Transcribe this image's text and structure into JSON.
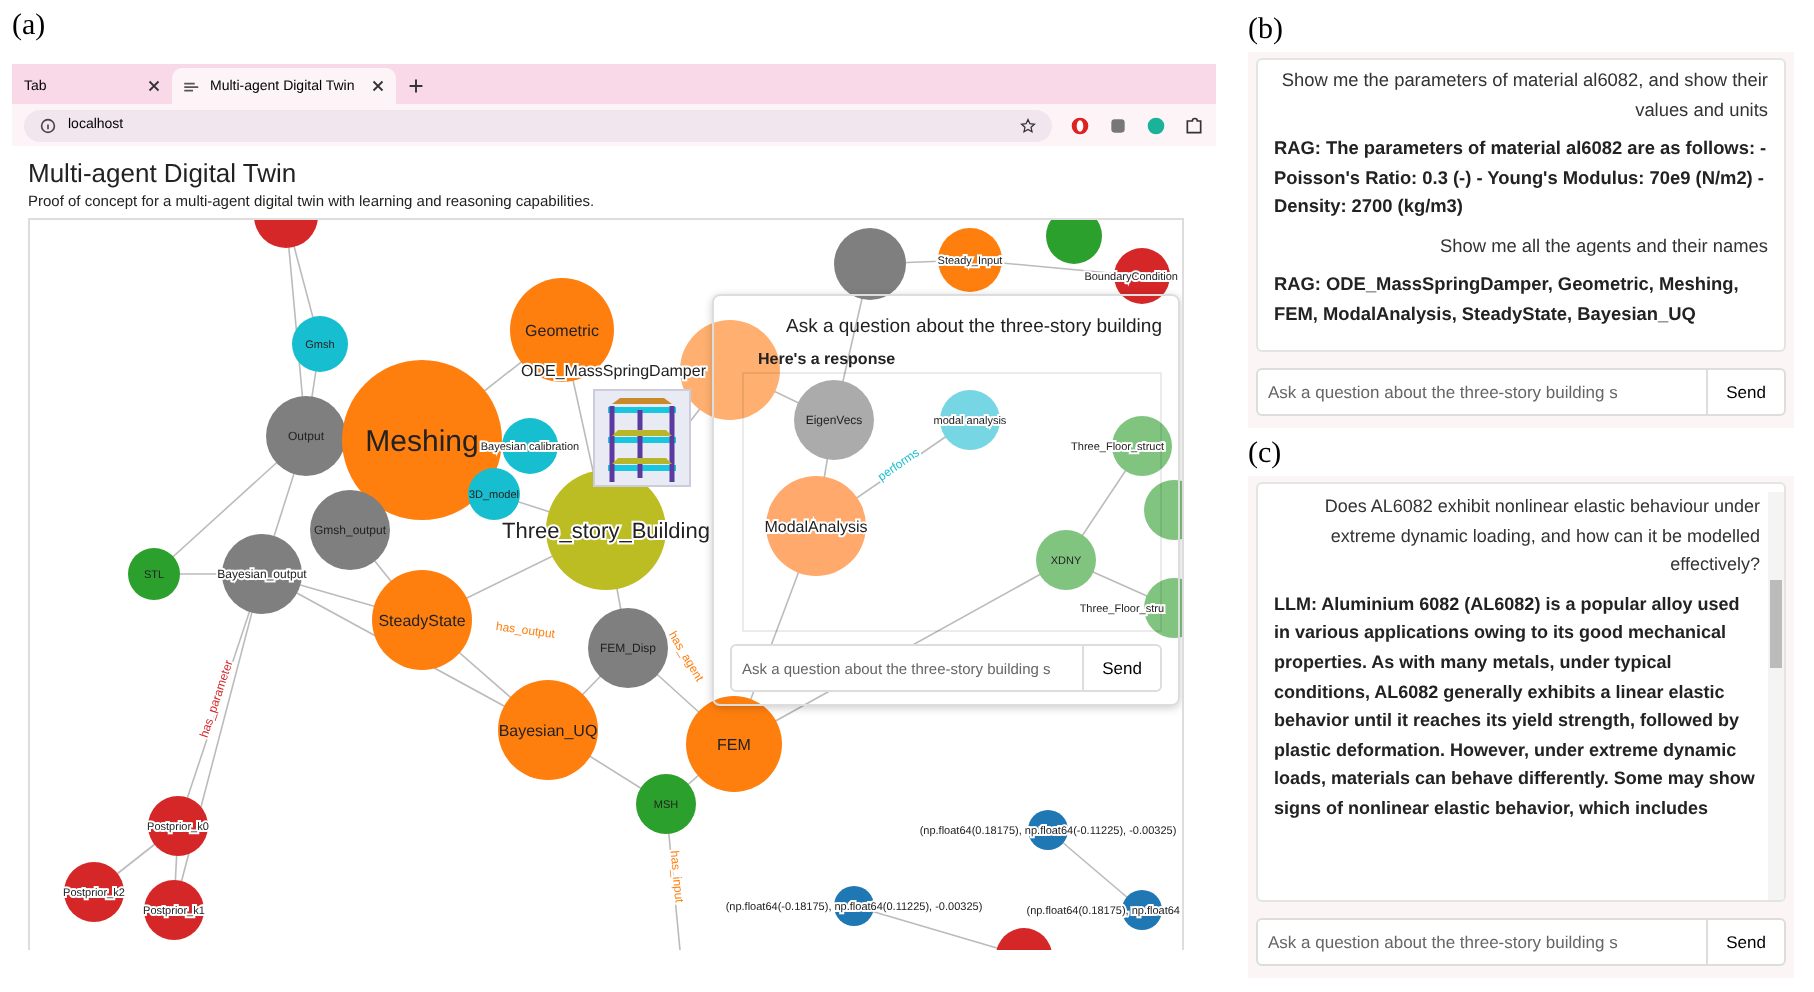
{
  "panel_labels": [
    "(a)",
    "(b)",
    "(c)"
  ],
  "browser": {
    "tabs": [
      {
        "label": "Tab",
        "selected": false
      },
      {
        "label": "Multi-agent Digital Twin",
        "selected": true
      }
    ],
    "url": "localhost"
  },
  "page": {
    "title": "Multi-agent Digital Twin",
    "subtitle": "Proof of concept for a multi-agent digital twin with learning and reasoning capabilities."
  },
  "graph": {
    "nodes": [
      {
        "color": "#d62728"
      },
      {
        "label": "Gmsh",
        "color": "#17becf"
      },
      {
        "label": "Geometric",
        "color": "#ff7f0e"
      },
      {
        "label": "Output",
        "color": "#7f7f7f"
      },
      {
        "label": "Meshing",
        "color": "#ff7f0e"
      },
      {
        "label": "Bayesian calibration",
        "color": "#17becf"
      },
      {
        "label": "3D_model",
        "color": "#17becf"
      },
      {
        "label": "Gmsh_output",
        "color": "#7f7f7f"
      },
      {
        "label": "Three_story_Building",
        "color": "#bcbd22"
      },
      {
        "label": "STL",
        "color": "#2ca02c"
      },
      {
        "label": "Bayesian_output",
        "color": "#7f7f7f"
      },
      {
        "label": "SteadyState",
        "color": "#ff7f0e"
      },
      {
        "label": "FEM_Disp",
        "color": "#7f7f7f"
      },
      {
        "label": "FEM",
        "color": "#ff7f0e"
      },
      {
        "label": "Bayesian_UQ",
        "color": "#ff7f0e"
      },
      {
        "label": "MSH",
        "color": "#2ca02c"
      },
      {
        "label": "ODE_MassSpringDamper",
        "color": "#ffb070"
      },
      {
        "label": "Steady_Input",
        "color": "#ff7f0e"
      },
      {
        "color": "#2ca02c"
      },
      {
        "label": "BoundaryCondition",
        "color": "#d62728"
      },
      {
        "color": "#7f7f7f"
      },
      {
        "label": "EigenVecs",
        "color": "#ababab"
      },
      {
        "label": "modal analysis",
        "color": "#76d6e4"
      },
      {
        "label": "ModalAnalysis",
        "color": "#ffaa6c"
      },
      {
        "label": "Three_Floor_struct",
        "color": "#80c480"
      },
      {
        "label": "XDNY",
        "color": "#80c480"
      },
      {
        "color": "#80c480"
      },
      {
        "label": "Three_Floor_stru",
        "color": "#80c480"
      },
      {
        "label": "Postprior_k0",
        "color": "#d62728"
      },
      {
        "label": "Postprior_k2",
        "color": "#d62728"
      },
      {
        "label": "Postprior_k1",
        "color": "#d62728"
      },
      {
        "label": "(np.float64(0.18175), np.float64(-0.11225), -0.00325)",
        "color": "#1f77b4"
      },
      {
        "label": "(np.float64(-0.18175), np.float64(0.11225), -0.00325)",
        "color": "#1f77b4"
      },
      {
        "label": "(np.float64(0.18175), np.float64",
        "color": "#1f77b4"
      },
      {
        "color": "#d62728"
      }
    ],
    "edge_labels": [
      "has_agent",
      "has_input",
      "has_output",
      "performs",
      "has_parameter"
    ],
    "chat": {
      "title": "Ask a question about the three-story building",
      "response_heading": "Here's a response",
      "placeholder": "Ask a question about the three-story building s",
      "send": "Send"
    }
  },
  "chat_b": {
    "messages": [
      {
        "kind": "user",
        "text": "Show me the parameters of material al6082, and show their values and units"
      },
      {
        "kind": "bot",
        "text": "RAG: The parameters of material al6082 are as follows: - Poisson's Ratio: 0.3 (-) - Young's Modulus: 70e9 (N/m2) - Density: 2700 (kg/m3)"
      },
      {
        "kind": "user",
        "text": "Show me all the agents and their names"
      },
      {
        "kind": "bot",
        "text": "RAG: ODE_MassSpringDamper, Geometric, Meshing, FEM, ModalAnalysis, SteadyState, Bayesian_UQ"
      }
    ],
    "placeholder": "Ask a question about the three-story building s",
    "send": "Send"
  },
  "chat_c": {
    "messages": [
      {
        "kind": "user",
        "text": "Does AL6082 exhibit nonlinear elastic behaviour under extreme dynamic loading, and how can it be modelled effectively?"
      },
      {
        "kind": "bot",
        "text": "LLM: Aluminium 6082 (AL6082) is a popular alloy used in various applications owing to its good mechanical properties. As with many metals, under typical conditions, AL6082 generally exhibits a linear elastic behavior until it reaches its yield strength, followed by plastic deformation. However, under extreme dynamic loads, materials can behave differently. Some may show signs of nonlinear elastic behavior, which includes"
      }
    ],
    "placeholder": "Ask a question about the three-story building s",
    "send": "Send"
  }
}
